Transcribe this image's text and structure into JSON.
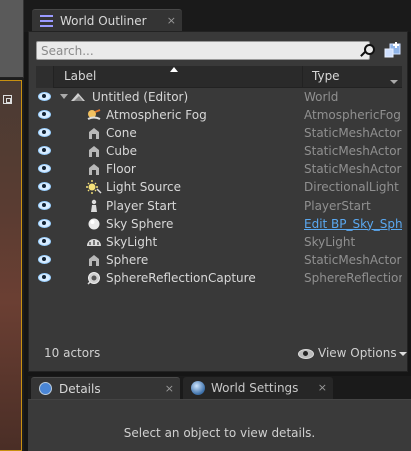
{
  "outliner": {
    "tab_title": "World Outliner",
    "tab_close": "×",
    "search_placeholder": "Search...",
    "columns": {
      "label": "Label",
      "type": "Type"
    },
    "rows": [
      {
        "label": "Untitled (Editor)",
        "type": "World",
        "icon": "world-icon",
        "indent": 0
      },
      {
        "label": "Atmospheric Fog",
        "type": "AtmosphericFog",
        "icon": "atmospheric-fog-icon",
        "indent": 1
      },
      {
        "label": "Cone",
        "type": "StaticMeshActor",
        "icon": "static-mesh-icon",
        "indent": 1
      },
      {
        "label": "Cube",
        "type": "StaticMeshActor",
        "icon": "static-mesh-icon",
        "indent": 1
      },
      {
        "label": "Floor",
        "type": "StaticMeshActor",
        "icon": "static-mesh-icon",
        "indent": 1
      },
      {
        "label": "Light Source",
        "type": "DirectionalLight",
        "icon": "directional-light-icon",
        "indent": 1
      },
      {
        "label": "Player Start",
        "type": "PlayerStart",
        "icon": "player-start-icon",
        "indent": 1
      },
      {
        "label": "Sky Sphere",
        "type": "Edit BP_Sky_Sphe",
        "icon": "sphere-icon",
        "indent": 1,
        "link": true
      },
      {
        "label": "SkyLight",
        "type": "SkyLight",
        "icon": "skylight-icon",
        "indent": 1
      },
      {
        "label": "Sphere",
        "type": "StaticMeshActor",
        "icon": "static-mesh-icon",
        "indent": 1
      },
      {
        "label": "SphereReflectionCapture",
        "type": "SphereReflectionC",
        "icon": "reflection-capture-icon",
        "indent": 1
      }
    ],
    "actor_count": "10 actors",
    "view_options": "View Options"
  },
  "bottom": {
    "details_tab": "Details",
    "details_close": "×",
    "world_settings_tab": "World Settings",
    "world_settings_close": "×",
    "details_message": "Select an object to view details."
  },
  "colors": {
    "accent_link": "#5aa8f0",
    "panel_bg": "#393939",
    "eye_icon": "#d8ecff"
  }
}
